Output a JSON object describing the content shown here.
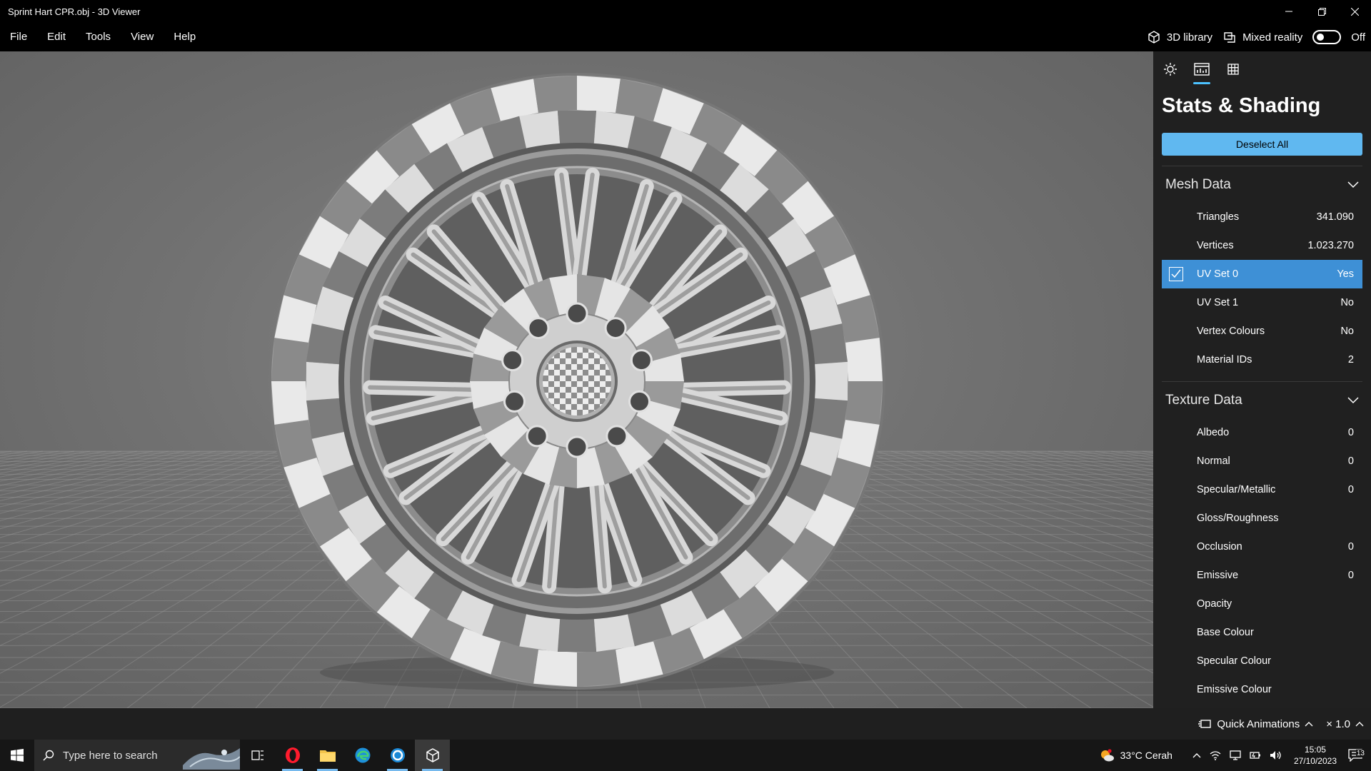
{
  "window": {
    "title": "Sprint Hart CPR.obj - 3D Viewer",
    "minimize_icon": "minimize-icon",
    "restore_icon": "restore-icon",
    "close_icon": "close-icon"
  },
  "menu": {
    "items": [
      "File",
      "Edit",
      "Tools",
      "View",
      "Help"
    ],
    "library_label": "3D library",
    "mixed_reality_label": "Mixed reality",
    "mixed_reality_state": "Off"
  },
  "panel": {
    "title": "Stats & Shading",
    "deselect_label": "Deselect All",
    "tabs": [
      "lighting-icon",
      "stats-icon",
      "grid-icon"
    ],
    "mesh_section": "Mesh Data",
    "mesh_rows": [
      {
        "label": "Triangles",
        "value": "341.090"
      },
      {
        "label": "Vertices",
        "value": "1.023.270"
      },
      {
        "label": "UV Set 0",
        "value": "Yes"
      },
      {
        "label": "UV Set 1",
        "value": "No"
      },
      {
        "label": "Vertex Colours",
        "value": "No"
      },
      {
        "label": "Material IDs",
        "value": "2"
      }
    ],
    "texture_section": "Texture Data",
    "texture_rows": [
      {
        "label": "Albedo",
        "value": "0"
      },
      {
        "label": "Normal",
        "value": "0"
      },
      {
        "label": "Specular/Metallic",
        "value": "0"
      },
      {
        "label": "Gloss/Roughness",
        "value": ""
      },
      {
        "label": "Occlusion",
        "value": "0"
      },
      {
        "label": "Emissive",
        "value": "0"
      },
      {
        "label": "Opacity",
        "value": ""
      },
      {
        "label": "Base Colour",
        "value": ""
      },
      {
        "label": "Specular Colour",
        "value": ""
      },
      {
        "label": "Emissive Colour",
        "value": ""
      }
    ]
  },
  "statusbar": {
    "quick_animations": "Quick Animations",
    "speed": "× 1.0"
  },
  "taskbar": {
    "search_placeholder": "Type here to search",
    "weather": "33°C  Cerah",
    "time": "15:05",
    "date": "27/10/2023",
    "notification_count": "13"
  },
  "colors": {
    "accent": "#60b8f0",
    "selected_row": "#3e90d6",
    "panel_bg": "#202020",
    "titlebar_bg": "#000000"
  }
}
